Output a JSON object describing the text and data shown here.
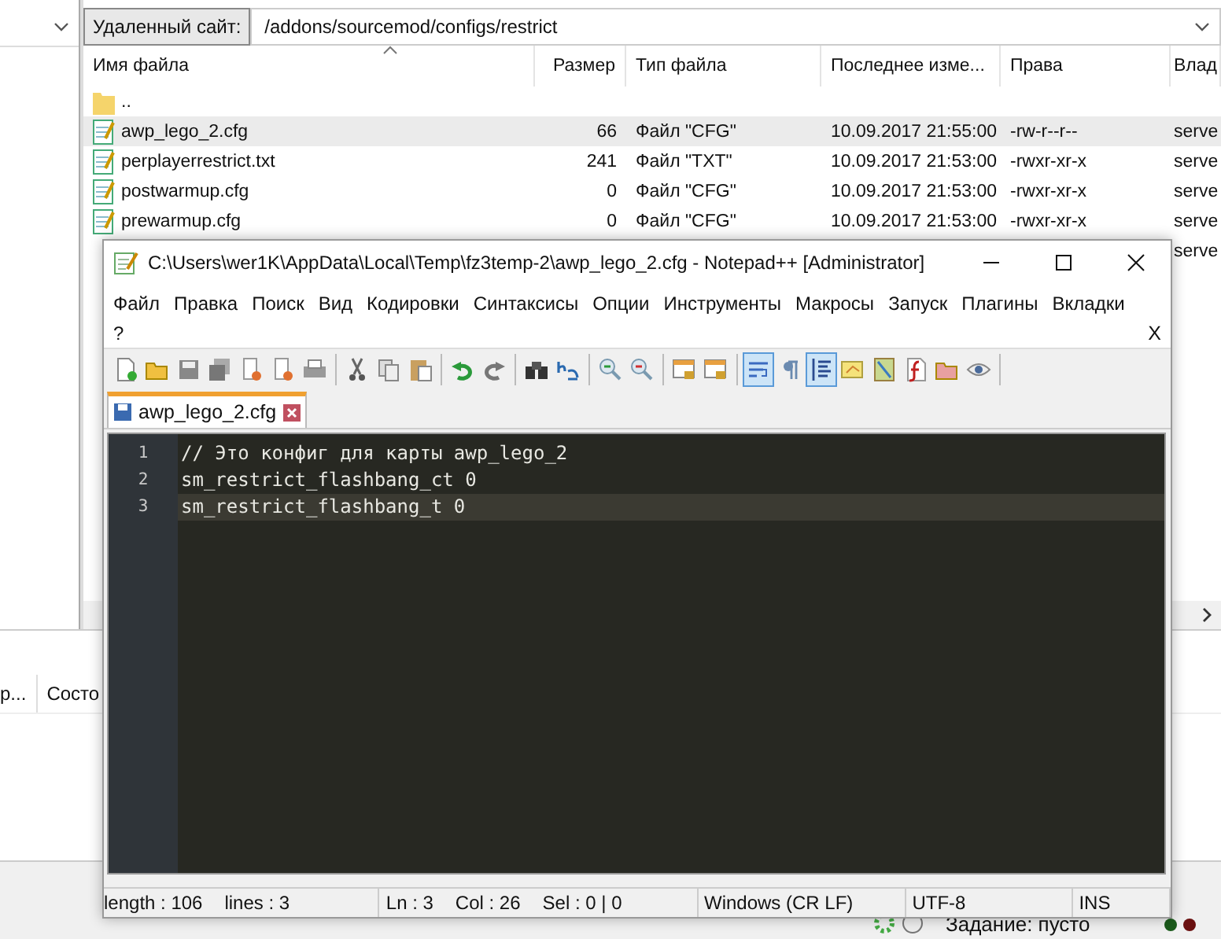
{
  "remote_site": {
    "label": "Удаленный сайт:",
    "path": "/addons/sourcemod/configs/restrict"
  },
  "file_table": {
    "columns": [
      "Имя файла",
      "Размер",
      "Тип файла",
      "Последнее изме...",
      "Права",
      "Влад"
    ],
    "rows": [
      {
        "kind": "folder",
        "name": "..",
        "size": "",
        "type": "",
        "modified": "",
        "perms": "",
        "owner": "",
        "selected": false
      },
      {
        "kind": "file",
        "name": "awp_lego_2.cfg",
        "size": "66",
        "type": "Файл \"CFG\"",
        "modified": "10.09.2017 21:55:00",
        "perms": "-rw-r--r--",
        "owner": "serve",
        "selected": true
      },
      {
        "kind": "file",
        "name": "perplayerrestrict.txt",
        "size": "241",
        "type": "Файл \"TXT\"",
        "modified": "10.09.2017 21:53:00",
        "perms": "-rwxr-xr-x",
        "owner": "serve",
        "selected": false
      },
      {
        "kind": "file",
        "name": "postwarmup.cfg",
        "size": "0",
        "type": "Файл \"CFG\"",
        "modified": "10.09.2017 21:53:00",
        "perms": "-rwxr-xr-x",
        "owner": "serve",
        "selected": false
      },
      {
        "kind": "file",
        "name": "prewarmup.cfg",
        "size": "0",
        "type": "Файл \"CFG\"",
        "modified": "10.09.2017 21:53:00",
        "perms": "-rwxr-xr-x",
        "owner": "serve",
        "selected": false
      },
      {
        "kind": "hidden",
        "name": "",
        "size": "",
        "type": "",
        "modified": "",
        "perms": "",
        "owner": "serve",
        "selected": false
      }
    ]
  },
  "queue": {
    "columns": [
      "р...",
      "Состо"
    ]
  },
  "status_bar": {
    "text": "Задание: пусто"
  },
  "notepad": {
    "title": "C:\\Users\\wer1K\\AppData\\Local\\Temp\\fz3temp-2\\awp_lego_2.cfg - Notepad++ [Administrator]",
    "menu": [
      "Файл",
      "Правка",
      "Поиск",
      "Вид",
      "Кодировки",
      "Синтаксисы",
      "Опции",
      "Инструменты",
      "Макросы",
      "Запуск",
      "Плагины",
      "Вкладки",
      "?"
    ],
    "menu_close": "X",
    "toolbar": [
      {
        "kind": "new",
        "pressed": false
      },
      {
        "kind": "open",
        "pressed": false
      },
      {
        "kind": "save",
        "pressed": false
      },
      {
        "kind": "saveall",
        "pressed": false
      },
      {
        "kind": "close",
        "pressed": false
      },
      {
        "kind": "closeall",
        "pressed": false
      },
      {
        "kind": "print",
        "pressed": false
      },
      {
        "kind": "separator"
      },
      {
        "kind": "cut",
        "pressed": false
      },
      {
        "kind": "copy",
        "pressed": false
      },
      {
        "kind": "paste",
        "pressed": false
      },
      {
        "kind": "separator"
      },
      {
        "kind": "undo",
        "pressed": false
      },
      {
        "kind": "redo",
        "pressed": false
      },
      {
        "kind": "separator"
      },
      {
        "kind": "find",
        "pressed": false
      },
      {
        "kind": "replace",
        "pressed": false
      },
      {
        "kind": "separator"
      },
      {
        "kind": "zoomin",
        "pressed": false
      },
      {
        "kind": "zoomout",
        "pressed": false
      },
      {
        "kind": "separator"
      },
      {
        "kind": "syncv",
        "pressed": false
      },
      {
        "kind": "synch",
        "pressed": false
      },
      {
        "kind": "separator"
      },
      {
        "kind": "wrap",
        "pressed": true
      },
      {
        "kind": "pilcrow",
        "pressed": false
      },
      {
        "kind": "indent",
        "pressed": true
      },
      {
        "kind": "panel",
        "pressed": false
      },
      {
        "kind": "map",
        "pressed": false
      },
      {
        "kind": "func",
        "pressed": false
      },
      {
        "kind": "folder",
        "pressed": false
      },
      {
        "kind": "eye",
        "pressed": false
      },
      {
        "kind": "separator"
      }
    ],
    "tabs": [
      {
        "label": "awp_lego_2.cfg",
        "selected": true
      }
    ],
    "lines": [
      {
        "number": "1",
        "text": "// Это конфиг для карты awp_lego_2",
        "current": false
      },
      {
        "number": "2",
        "text": "sm_restrict_flashbang_ct 0",
        "current": false
      },
      {
        "number": "3",
        "text": "sm_restrict_flashbang_t 0",
        "current": true
      }
    ],
    "status": [
      [
        "length : 106",
        "lines : 3"
      ],
      [
        "Ln : 3",
        "Col : 26",
        "Sel : 0 | 0"
      ],
      [
        "Windows (CR LF)"
      ],
      [
        "UTF-8"
      ],
      [
        "INS"
      ]
    ]
  }
}
